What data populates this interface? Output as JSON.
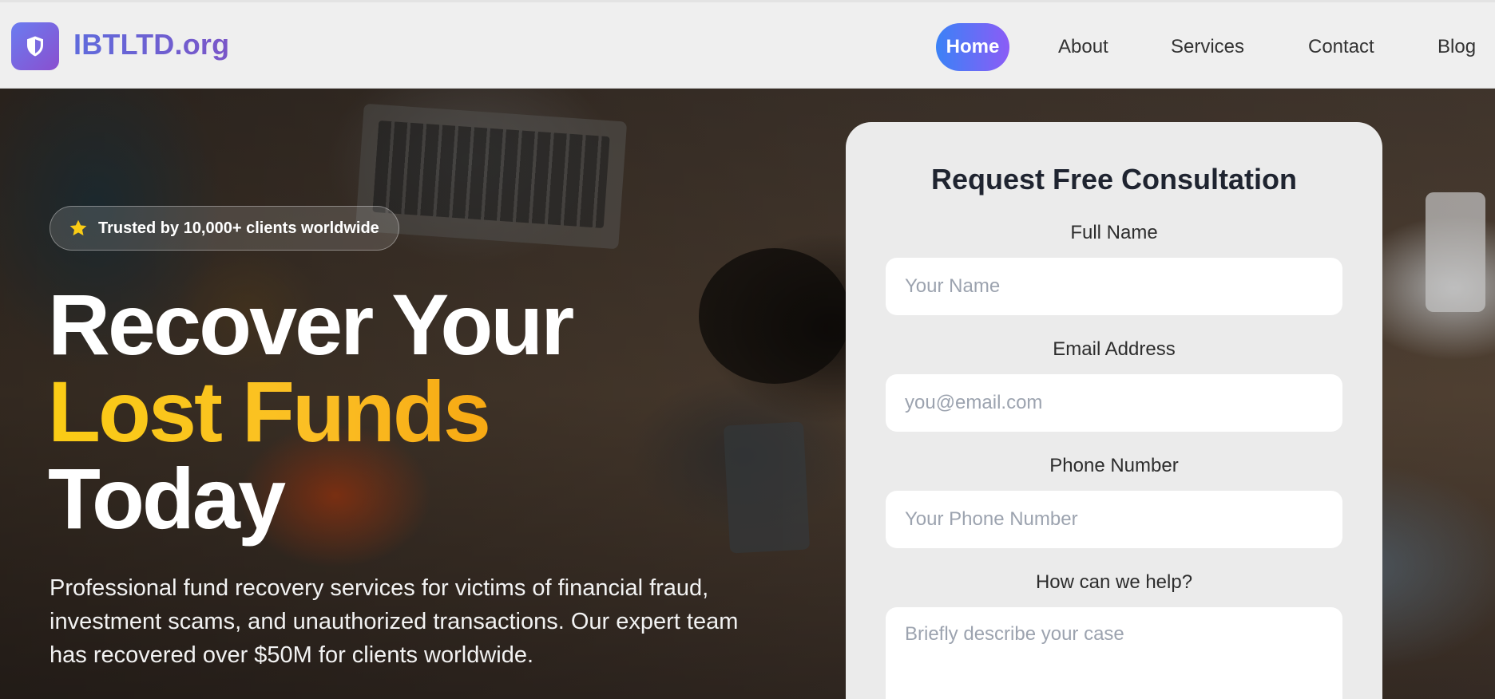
{
  "brand": {
    "name": "IBTLTD.org",
    "logo_icon": "shield-icon",
    "gradient": [
      "#6a7cf0",
      "#8a4fcf"
    ]
  },
  "nav": {
    "items": [
      {
        "label": "Home",
        "active": true
      },
      {
        "label": "About",
        "active": false
      },
      {
        "label": "Services",
        "active": false
      },
      {
        "label": "Contact",
        "active": false
      },
      {
        "label": "Blog",
        "active": false
      }
    ],
    "active_color": "#3b82f6"
  },
  "hero": {
    "badge": {
      "icon": "star-icon",
      "text": "Trusted by 10,000+ clients worldwide"
    },
    "headline": {
      "line1": "Recover Your",
      "line2": "Lost Funds",
      "line3": "Today"
    },
    "highlight_color": "#facc15",
    "subtext": "Professional fund recovery services for victims of financial fraud, investment scams, and unauthorized transactions. Our expert team has recovered over $50M for clients worldwide."
  },
  "form": {
    "title": "Request Free Consultation",
    "fields": [
      {
        "label": "Full Name",
        "placeholder": "Your Name",
        "value": ""
      },
      {
        "label": "Email Address",
        "placeholder": "you@email.com",
        "value": ""
      },
      {
        "label": "Phone Number",
        "placeholder": "Your Phone Number",
        "value": ""
      },
      {
        "label": "How can we help?",
        "placeholder": "Briefly describe your case",
        "value": ""
      }
    ]
  }
}
